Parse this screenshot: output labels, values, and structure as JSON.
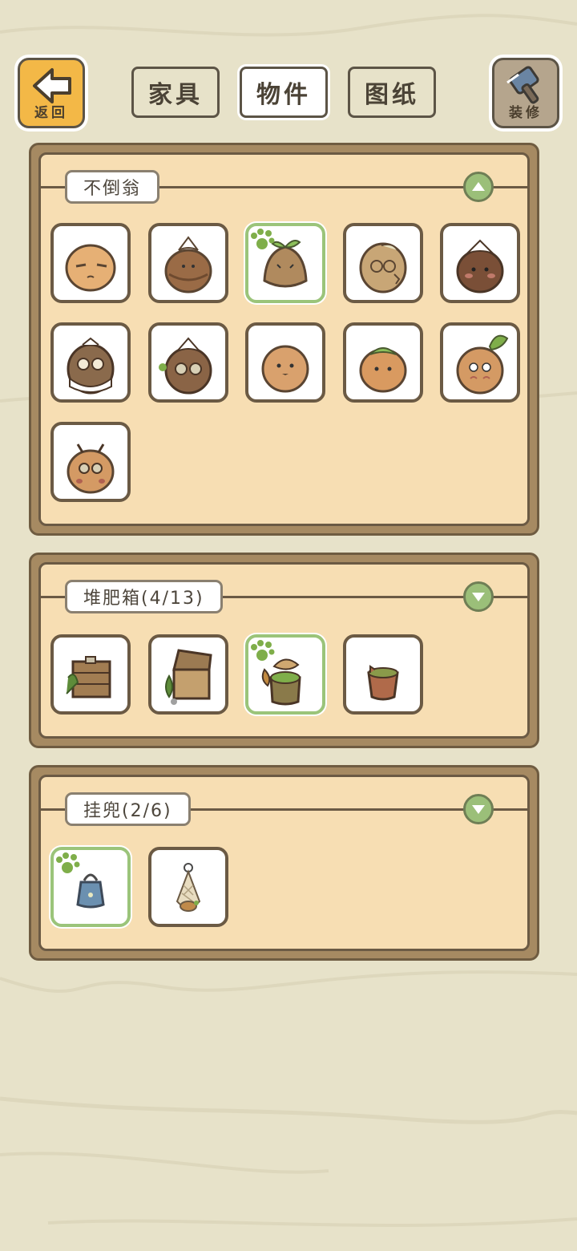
{
  "topbar": {
    "back_label": "返回",
    "decorate_label": "装修",
    "tabs": [
      {
        "label": "家具",
        "active": false
      },
      {
        "label": "物件",
        "active": true
      },
      {
        "label": "图纸",
        "active": false
      }
    ]
  },
  "sections": [
    {
      "title": "不倒翁",
      "expanded": true,
      "items": [
        {
          "icon": "daruma-plain-icon",
          "selected": false
        },
        {
          "icon": "daruma-bud-icon",
          "selected": false
        },
        {
          "icon": "daruma-sprout-icon",
          "selected": true
        },
        {
          "icon": "daruma-cracked-icon",
          "selected": false
        },
        {
          "icon": "daruma-dark-icon",
          "selected": false
        },
        {
          "icon": "daruma-owl-icon",
          "selected": false
        },
        {
          "icon": "daruma-glasses-icon",
          "selected": false
        },
        {
          "icon": "daruma-round-icon",
          "selected": false
        },
        {
          "icon": "daruma-leaf-icon",
          "selected": false
        },
        {
          "icon": "daruma-turnip-icon",
          "selected": false
        },
        {
          "icon": "daruma-ladybug-icon",
          "selected": false
        }
      ]
    },
    {
      "title": "堆肥箱(4/13)",
      "expanded": false,
      "items": [
        {
          "icon": "compost-crate-icon",
          "selected": false
        },
        {
          "icon": "compost-chest-icon",
          "selected": false
        },
        {
          "icon": "compost-stump-icon",
          "selected": true
        },
        {
          "icon": "compost-bucket-icon",
          "selected": false
        }
      ]
    },
    {
      "title": "挂兜(2/6)",
      "expanded": false,
      "items": [
        {
          "icon": "hanging-bag-icon",
          "selected": true
        },
        {
          "icon": "hanging-net-icon",
          "selected": false
        }
      ]
    }
  ],
  "colors": {
    "background": "#e7e2c9",
    "panel": "#f7deb3",
    "selected_border": "#9bc47a",
    "toggle": "#9bbf79"
  }
}
